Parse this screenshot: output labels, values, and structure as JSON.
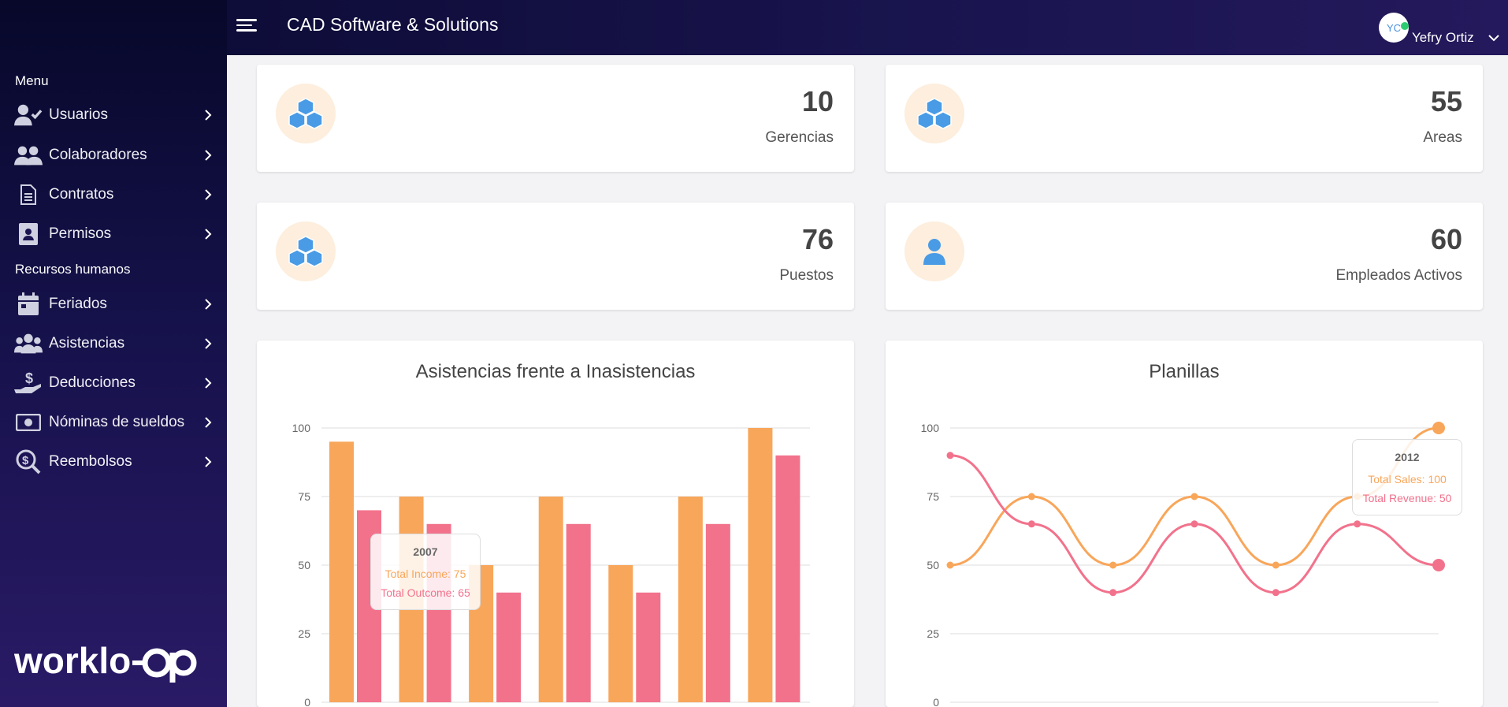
{
  "topbar": {
    "app_title": "CAD Software & Solutions",
    "avatar_initials": "YC",
    "user_name": "Yefry Ortiz"
  },
  "sidebar": {
    "section_menu": "Menu",
    "section_hr": "Recursos humanos",
    "items": [
      {
        "label": "Usuarios",
        "icon": "user-check-icon"
      },
      {
        "label": "Colaboradores",
        "icon": "users-icon"
      },
      {
        "label": "Contratos",
        "icon": "document-icon"
      },
      {
        "label": "Permisos",
        "icon": "id-badge-icon"
      },
      {
        "label": "Feriados",
        "icon": "calendar-icon"
      },
      {
        "label": "Asistencias",
        "icon": "group-icon"
      },
      {
        "label": "Deducciones",
        "icon": "hand-dollar-icon"
      },
      {
        "label": "Nóminas de sueldos",
        "icon": "money-bill-icon"
      },
      {
        "label": "Reembolsos",
        "icon": "search-dollar-icon"
      }
    ],
    "logo_text": "workloop"
  },
  "stats": [
    {
      "value": "10",
      "label": "Gerencias",
      "icon": "cubes-icon"
    },
    {
      "value": "55",
      "label": "Areas",
      "icon": "cubes-icon"
    },
    {
      "value": "76",
      "label": "Puestos",
      "icon": "cubes-icon"
    },
    {
      "value": "60",
      "label": "Empleados Activos",
      "icon": "user-icon"
    }
  ],
  "colors": {
    "orange": "#f8a65a",
    "pink": "#f2728c",
    "iconBlue": "#4a9be6",
    "iconBg": "#fdeedd"
  },
  "chart_data": [
    {
      "type": "bar",
      "title": "Asistencias frente a Inasistencias",
      "ylim": [
        0,
        100
      ],
      "yticks": [
        "0",
        "25",
        "50",
        "75",
        "100"
      ],
      "series": [
        {
          "name": "Total Income",
          "color": "#f8a65a",
          "values": [
            95,
            75,
            50,
            75,
            50,
            75,
            100
          ]
        },
        {
          "name": "Total Outcome",
          "color": "#f2728c",
          "values": [
            70,
            65,
            40,
            65,
            40,
            65,
            90
          ]
        }
      ],
      "tooltip": {
        "title": "2007",
        "line1": "Total Income: 75",
        "line2": "Total Outcome: 65"
      }
    },
    {
      "type": "line",
      "title": "Planillas",
      "ylim": [
        0,
        100
      ],
      "yticks": [
        "0",
        "25",
        "50",
        "75",
        "100"
      ],
      "series": [
        {
          "name": "Total Sales",
          "color": "#f8a65a",
          "values": [
            50,
            75,
            50,
            75,
            50,
            75,
            100
          ]
        },
        {
          "name": "Total Revenue",
          "color": "#f2728c",
          "values": [
            90,
            65,
            40,
            65,
            40,
            65,
            50
          ]
        }
      ],
      "tooltip": {
        "title": "2012",
        "line1": "Total Sales: 100",
        "line2": "Total Revenue: 50"
      }
    }
  ]
}
